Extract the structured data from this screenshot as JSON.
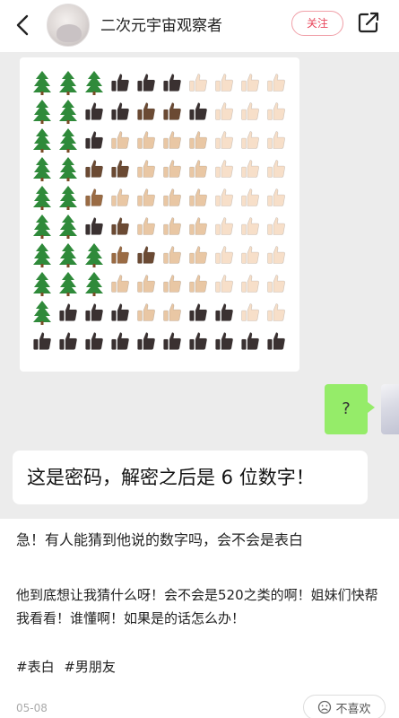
{
  "header": {
    "author_name": "二次元宇宙观察者",
    "follow_label": "关注"
  },
  "emoji_grid": {
    "rows": [
      [
        "tree",
        "tree",
        "tree",
        "d5",
        "d5",
        "d5",
        "t1",
        "t1",
        "t1",
        "t1"
      ],
      [
        "tree",
        "tree",
        "d5",
        "d5",
        "d4",
        "d4",
        "d5",
        "t1",
        "t1",
        "t1"
      ],
      [
        "tree",
        "tree",
        "d5",
        "t2",
        "t2",
        "t2",
        "t2",
        "t1",
        "t1",
        "t1"
      ],
      [
        "tree",
        "tree",
        "d4",
        "d4",
        "t2",
        "t2",
        "t2",
        "t1",
        "t1",
        "t1"
      ],
      [
        "tree",
        "tree",
        "d3",
        "t2",
        "t2",
        "t2",
        "t2",
        "t1",
        "t1",
        "t1"
      ],
      [
        "tree",
        "tree",
        "d5",
        "d4",
        "t2",
        "t2",
        "t2",
        "t1",
        "t1",
        "t1"
      ],
      [
        "tree",
        "tree",
        "tree",
        "d3",
        "d4",
        "t2",
        "t2",
        "t1",
        "t1",
        "t1"
      ],
      [
        "tree",
        "tree",
        "tree",
        "t2",
        "t2",
        "t2",
        "t2",
        "t1",
        "t1",
        "t1"
      ],
      [
        "tree",
        "d5",
        "d5",
        "d5",
        "t2",
        "t2",
        "d5",
        "d5",
        "t1",
        "t1"
      ],
      [
        "d5",
        "d5",
        "d5",
        "d5",
        "d5",
        "d5",
        "d5",
        "d5",
        "d5",
        "d5"
      ]
    ],
    "colors": {
      "tree": "#2f8a3a",
      "d5": "#3a3131",
      "d4": "#6b4a33",
      "d3": "#9a6b44",
      "t2": "#e9c7a4",
      "t1": "#f7dfc9"
    }
  },
  "question_bubble": "?",
  "caption": "这是密码，解密之后是 6 位数字！",
  "post": {
    "title": "急！有人能猜到他说的数字吗，会不会是表白",
    "body": "他到底想让我猜什么呀！会不会是520之类的啊！姐妹们快帮我看看！谁懂啊！如果是的话怎么办！",
    "tags": [
      "#表白",
      "#男朋友"
    ],
    "date": "05-08",
    "dislike_label": "不喜欢"
  }
}
